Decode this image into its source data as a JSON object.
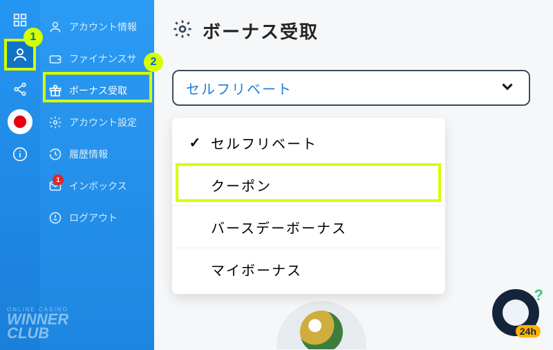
{
  "rail": {
    "items": [
      {
        "name": "apps-icon"
      },
      {
        "name": "account-icon",
        "active": true
      },
      {
        "name": "share-icon"
      },
      {
        "name": "japan-flag-icon"
      },
      {
        "name": "info-icon"
      }
    ]
  },
  "menu": {
    "items": [
      {
        "icon": "user-icon",
        "label": "アカウント情報"
      },
      {
        "icon": "wallet-icon",
        "label": "ファイナンスサ"
      },
      {
        "icon": "gift-icon",
        "label": "ボーナス受取",
        "active": true
      },
      {
        "icon": "gear-icon",
        "label": "アカウント設定"
      },
      {
        "icon": "history-icon",
        "label": "履歴情報"
      },
      {
        "icon": "mail-icon",
        "label": "インボックス",
        "badge": "1"
      },
      {
        "icon": "logout-icon",
        "label": "ログアウト"
      }
    ]
  },
  "page": {
    "title": "ボーナス受取"
  },
  "select": {
    "value": "セルフリベート",
    "options": [
      {
        "label": "セルフリベート",
        "selected": true
      },
      {
        "label": "クーポン",
        "highlight": true
      },
      {
        "label": "バースデーボーナス"
      },
      {
        "label": "マイボーナス"
      }
    ]
  },
  "annotations": {
    "num1": "1",
    "num2": "2"
  },
  "support": {
    "tag": "24h",
    "q": "?"
  },
  "logo": {
    "small": "ONLINE CASINO",
    "line1": "WINNER",
    "line2": "CLUB"
  }
}
